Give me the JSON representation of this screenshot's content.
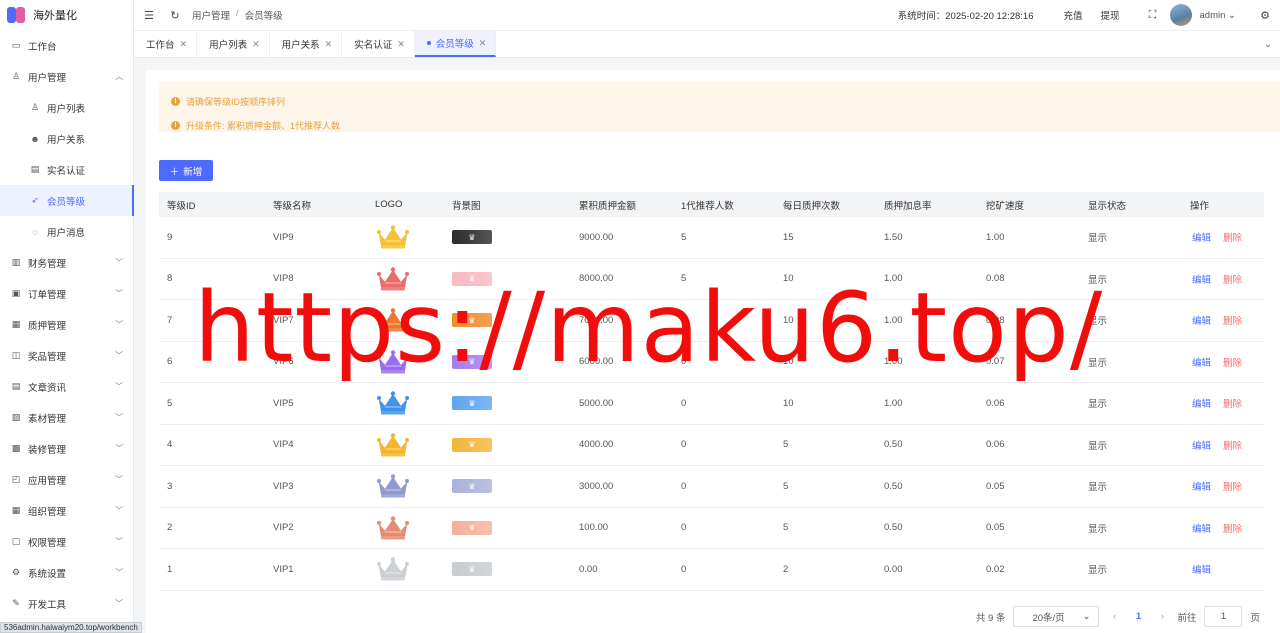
{
  "app": {
    "title": "海外量化"
  },
  "sidebar": {
    "items": [
      {
        "label": "工作台",
        "icon": "monitor-icon",
        "sub": false,
        "expand": ""
      },
      {
        "label": "用户管理",
        "icon": "user-icon",
        "sub": false,
        "expand": "up"
      },
      {
        "label": "用户列表",
        "icon": "user-outline-icon",
        "sub": true,
        "expand": ""
      },
      {
        "label": "用户关系",
        "icon": "users-icon",
        "sub": true,
        "expand": ""
      },
      {
        "label": "实名认证",
        "icon": "id-card-icon",
        "sub": true,
        "expand": ""
      },
      {
        "label": "会员等级",
        "icon": "rocket-icon",
        "sub": true,
        "expand": "",
        "active": true
      },
      {
        "label": "用户消息",
        "icon": "message-icon",
        "sub": true,
        "expand": ""
      },
      {
        "label": "财务管理",
        "icon": "chart-icon",
        "sub": false,
        "expand": "down"
      },
      {
        "label": "订单管理",
        "icon": "order-icon",
        "sub": false,
        "expand": "down"
      },
      {
        "label": "质押管理",
        "icon": "stack-icon",
        "sub": false,
        "expand": "down"
      },
      {
        "label": "奖品管理",
        "icon": "gift-icon",
        "sub": false,
        "expand": "down"
      },
      {
        "label": "文章资讯",
        "icon": "article-icon",
        "sub": false,
        "expand": "down"
      },
      {
        "label": "素材管理",
        "icon": "image-icon",
        "sub": false,
        "expand": "down"
      },
      {
        "label": "装修管理",
        "icon": "paint-icon",
        "sub": false,
        "expand": "down"
      },
      {
        "label": "应用管理",
        "icon": "app-icon",
        "sub": false,
        "expand": "down"
      },
      {
        "label": "组织管理",
        "icon": "building-icon",
        "sub": false,
        "expand": "down"
      },
      {
        "label": "权限管理",
        "icon": "lock-icon",
        "sub": false,
        "expand": "down"
      },
      {
        "label": "系统设置",
        "icon": "gear-icon",
        "sub": false,
        "expand": "down"
      },
      {
        "label": "开发工具",
        "icon": "wrench-icon",
        "sub": false,
        "expand": "down"
      }
    ]
  },
  "header": {
    "breadcrumb": [
      "用户管理",
      "会员等级"
    ],
    "breadcrumb_sep": "/",
    "system_time": "系统时间：2025-02-20 12:28:16",
    "recharge": "充值",
    "withdraw": "提现",
    "user": "admin"
  },
  "tabs": [
    {
      "label": "工作台",
      "active": false
    },
    {
      "label": "用户列表",
      "active": false
    },
    {
      "label": "用户关系",
      "active": false
    },
    {
      "label": "实名认证",
      "active": false
    },
    {
      "label": "会员等级",
      "active": true
    }
  ],
  "notice": [
    "请确保等级ID按顺序排列",
    "升级条件: 累积质押金额、1代推荐人数"
  ],
  "add_button": "新增",
  "table": {
    "columns": [
      "等级ID",
      "等级名称",
      "LOGO",
      "背景图",
      "累积质押金额",
      "1代推荐人数",
      "每日质押次数",
      "质押加息率",
      "挖矿速度",
      "显示状态",
      "操作"
    ],
    "edit_label": "编辑",
    "delete_label": "删除",
    "rows": [
      {
        "id": "9",
        "name": "VIP9",
        "amount": "9000.00",
        "refs": "5",
        "daily": "15",
        "rate": "1.50",
        "speed": "1.00",
        "status": "显示",
        "crown": "#f5c330",
        "bg": "#2b2b2b",
        "deletable": true
      },
      {
        "id": "8",
        "name": "VIP8",
        "amount": "8000.00",
        "refs": "5",
        "daily": "10",
        "rate": "1.00",
        "speed": "0.08",
        "status": "显示",
        "crown": "#ee6b6b",
        "bg": "#f7b9bf",
        "deletable": true
      },
      {
        "id": "7",
        "name": "VIP7",
        "amount": "7000.00",
        "refs": "0",
        "daily": "10",
        "rate": "1.00",
        "speed": "0.08",
        "status": "显示",
        "crown": "#f0762b",
        "bg": "#f28a2c",
        "deletable": true
      },
      {
        "id": "6",
        "name": "VIP6",
        "amount": "6000.00",
        "refs": "0",
        "daily": "10",
        "rate": "1.00",
        "speed": "0.07",
        "status": "显示",
        "crown": "#9b6cf0",
        "bg": "#a57cf0",
        "deletable": true
      },
      {
        "id": "5",
        "name": "VIP5",
        "amount": "5000.00",
        "refs": "0",
        "daily": "10",
        "rate": "1.00",
        "speed": "0.06",
        "status": "显示",
        "crown": "#3f93ef",
        "bg": "#5da4f2",
        "deletable": true
      },
      {
        "id": "4",
        "name": "VIP4",
        "amount": "4000.00",
        "refs": "0",
        "daily": "5",
        "rate": "0.50",
        "speed": "0.06",
        "status": "显示",
        "crown": "#f5b62a",
        "bg": "#f2b53a",
        "deletable": true
      },
      {
        "id": "3",
        "name": "VIP3",
        "amount": "3000.00",
        "refs": "0",
        "daily": "5",
        "rate": "0.50",
        "speed": "0.05",
        "status": "显示",
        "crown": "#8e9ad1",
        "bg": "#a9b2db",
        "deletable": true
      },
      {
        "id": "2",
        "name": "VIP2",
        "amount": "100.00",
        "refs": "0",
        "daily": "5",
        "rate": "0.50",
        "speed": "0.05",
        "status": "显示",
        "crown": "#ea8a6f",
        "bg": "#f4b09b",
        "deletable": true
      },
      {
        "id": "1",
        "name": "VIP1",
        "amount": "0.00",
        "refs": "0",
        "daily": "2",
        "rate": "0.00",
        "speed": "0.02",
        "status": "显示",
        "crown": "#cdd1d6",
        "bg": "#c7ccd1",
        "deletable": false
      }
    ]
  },
  "pagination": {
    "total": "共 9 条",
    "page_size": "20条/页",
    "current": "1",
    "goto_label": "前往",
    "goto_value": "1",
    "page_suffix": "页"
  },
  "watermark": "https://maku6.top/",
  "statusbar_url": "536admin.haiwaiym20.top/workbench",
  "colors": {
    "primary": "#4d6bff",
    "danger": "#f56c6c",
    "warning": "#e6a23c",
    "watermark": "#f20d0d"
  }
}
